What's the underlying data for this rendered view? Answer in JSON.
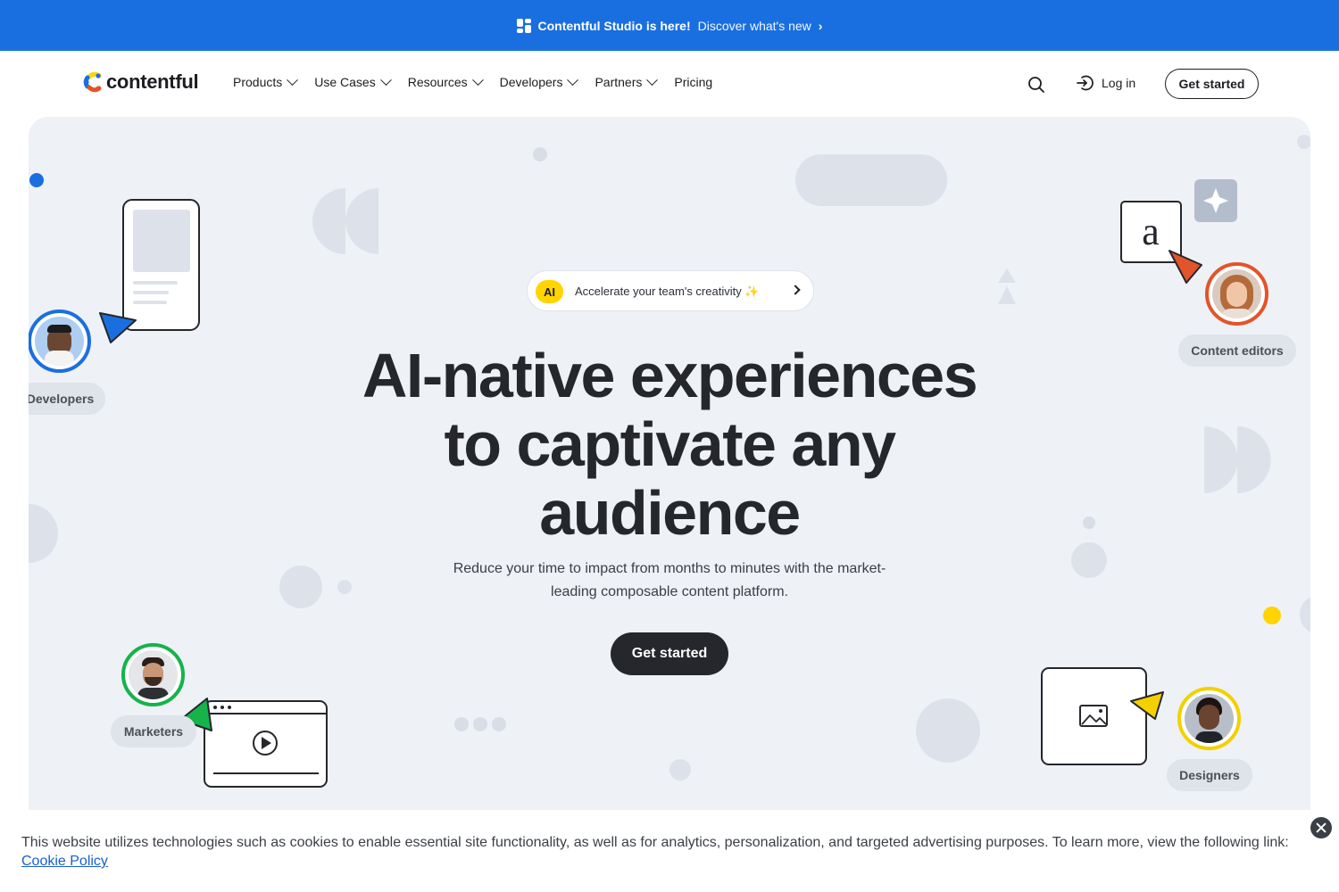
{
  "announcement": {
    "title": "Contentful Studio is here!",
    "link": "Discover what's new",
    "icon": "studio-icon"
  },
  "nav": {
    "logo_text": "contentful",
    "links": [
      {
        "label": "Products",
        "has_menu": true
      },
      {
        "label": "Use Cases",
        "has_menu": true
      },
      {
        "label": "Resources",
        "has_menu": true
      },
      {
        "label": "Developers",
        "has_menu": true
      },
      {
        "label": "Partners",
        "has_menu": true
      },
      {
        "label": "Pricing",
        "has_menu": false
      }
    ],
    "login": "Log in",
    "cta": "Get started"
  },
  "hero": {
    "pill_badge": "AI",
    "pill_text": "Accelerate your team's creativity",
    "headline_lines": [
      "AI-native experiences",
      "to captivate any",
      "audience"
    ],
    "subtext_lines": [
      "Reduce your time to impact from months to minutes with the market-",
      "leading composable content platform."
    ],
    "cta": "Get started",
    "roles": {
      "developers": "Developers",
      "content_editors": "Content editors",
      "marketers": "Marketers",
      "designers": "Designers"
    },
    "editor_letter": "a"
  },
  "cookie": {
    "text": "This website utilizes technologies such as cookies to enable essential site functionality, as well as for analytics, personalization, and targeted advertising purposes. To learn more, view the following link:",
    "link": "Cookie Policy"
  },
  "colors": {
    "announce_bg": "#1a6fe0",
    "hero_bg": "#eef1f6",
    "accent_yellow": "#ffd400",
    "developer_blue": "#1a6fe0",
    "editor_orange": "#e2542a",
    "marketer_green": "#15b34a",
    "designer_yellow": "#f4d000"
  }
}
